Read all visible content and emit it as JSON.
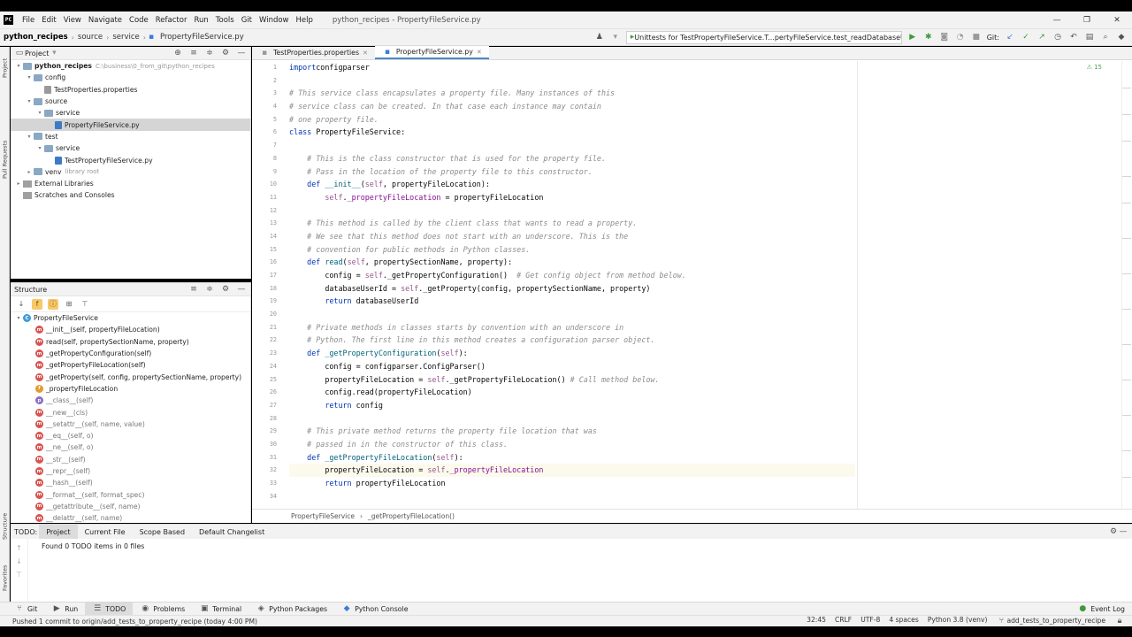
{
  "menu": [
    "File",
    "Edit",
    "View",
    "Navigate",
    "Code",
    "Refactor",
    "Run",
    "Tools",
    "Git",
    "Window",
    "Help"
  ],
  "window_title": "python_recipes - PropertyFileService.py",
  "breadcrumb": [
    "python_recipes",
    "source",
    "service",
    "PropertyFileService.py"
  ],
  "run_config": "Unittests for TestPropertyFileService.T...pertyFileService.test_readDatabaseUserId",
  "git_label": "Git:",
  "project_panel": {
    "title": "Project",
    "tree": [
      {
        "label": "python_recipes",
        "hint": "C:\\business\\0_from_git\\python_recipes",
        "depth": 0,
        "type": "proj",
        "arrow": "▾"
      },
      {
        "label": "config",
        "depth": 1,
        "type": "folder",
        "arrow": "▾"
      },
      {
        "label": "TestProperties.properties",
        "depth": 2,
        "type": "prop",
        "arrow": ""
      },
      {
        "label": "source",
        "depth": 1,
        "type": "folder",
        "arrow": "▾"
      },
      {
        "label": "service",
        "depth": 2,
        "type": "folder",
        "arrow": "▾"
      },
      {
        "label": "PropertyFileService.py",
        "depth": 3,
        "type": "py",
        "arrow": "",
        "selected": true
      },
      {
        "label": "test",
        "depth": 1,
        "type": "folder",
        "arrow": "▾"
      },
      {
        "label": "service",
        "depth": 2,
        "type": "folder",
        "arrow": "▾"
      },
      {
        "label": "TestPropertyFileService.py",
        "depth": 3,
        "type": "py",
        "arrow": ""
      },
      {
        "label": "venv",
        "hint": "library root",
        "depth": 1,
        "type": "folder",
        "arrow": "▸"
      },
      {
        "label": "External Libraries",
        "depth": 0,
        "type": "lib",
        "arrow": "▸"
      },
      {
        "label": "Scratches and Consoles",
        "depth": 0,
        "type": "lib",
        "arrow": ""
      }
    ]
  },
  "structure_panel": {
    "title": "Structure",
    "items": [
      {
        "label": "PropertyFileService",
        "badge": "c",
        "depth": 0
      },
      {
        "label": "__init__(self, propertyFileLocation)",
        "badge": "m",
        "depth": 1
      },
      {
        "label": "read(self, propertySectionName, property)",
        "badge": "m",
        "depth": 1
      },
      {
        "label": "_getPropertyConfiguration(self)",
        "badge": "m",
        "depth": 1
      },
      {
        "label": "_getPropertyFileLocation(self)",
        "badge": "m",
        "depth": 1
      },
      {
        "label": "_getProperty(self, config, propertySectionName, property)",
        "badge": "m",
        "depth": 1
      },
      {
        "label": "_propertyFileLocation",
        "badge": "f",
        "depth": 1
      },
      {
        "label": "__class__(self)",
        "badge": "p",
        "depth": 1,
        "dim": true
      },
      {
        "label": "__new__(cls)",
        "badge": "m",
        "depth": 1,
        "dim": true
      },
      {
        "label": "__setattr__(self, name, value)",
        "badge": "m",
        "depth": 1,
        "dim": true
      },
      {
        "label": "__eq__(self, o)",
        "badge": "m",
        "depth": 1,
        "dim": true
      },
      {
        "label": "__ne__(self, o)",
        "badge": "m",
        "depth": 1,
        "dim": true
      },
      {
        "label": "__str__(self)",
        "badge": "m",
        "depth": 1,
        "dim": true
      },
      {
        "label": "__repr__(self)",
        "badge": "m",
        "depth": 1,
        "dim": true
      },
      {
        "label": "__hash__(self)",
        "badge": "m",
        "depth": 1,
        "dim": true
      },
      {
        "label": "__format__(self, format_spec)",
        "badge": "m",
        "depth": 1,
        "dim": true
      },
      {
        "label": "__getattribute__(self, name)",
        "badge": "m",
        "depth": 1,
        "dim": true
      },
      {
        "label": "__delattr__(self, name)",
        "badge": "m",
        "depth": 1,
        "dim": true
      }
    ]
  },
  "editor": {
    "tabs": [
      {
        "label": "TestProperties.properties",
        "active": false
      },
      {
        "label": "PropertyFileService.py",
        "active": true
      }
    ],
    "inspection": "⚠ 15",
    "lines": [
      [
        [
          "kw",
          "import"
        ],
        [
          "",
          "configparser"
        ]
      ],
      [],
      [
        [
          "cm",
          "# This service class encapsulates a property file. Many instances of this"
        ]
      ],
      [
        [
          "cm",
          "# service class can be created. In that case each instance may contain"
        ]
      ],
      [
        [
          "cm",
          "# one property file."
        ]
      ],
      [
        [
          "kw",
          "class "
        ],
        [
          "",
          "PropertyFileService:"
        ]
      ],
      [],
      [
        [
          "cm",
          "    # This is the class constructor that is used for the property file."
        ]
      ],
      [
        [
          "cm",
          "    # Pass in the location of the property file to this constructor."
        ]
      ],
      [
        [
          "kw",
          "    def "
        ],
        [
          "fn",
          "__init__"
        ],
        [
          "",
          "("
        ],
        [
          "self",
          "self"
        ],
        [
          "",
          ", propertyFileLocation):"
        ]
      ],
      [
        [
          "self",
          "        self"
        ],
        [
          "",
          "."
        ],
        [
          "pv",
          "_propertyFileLocation"
        ],
        [
          "",
          " = propertyFileLocation"
        ]
      ],
      [],
      [
        [
          "cm",
          "    # This method is called by the client class that wants to read a property."
        ]
      ],
      [
        [
          "cm",
          "    # We see that this method does not start with an underscore. This is the"
        ]
      ],
      [
        [
          "cm",
          "    # convention for public methods in Python classes."
        ]
      ],
      [
        [
          "kw",
          "    def "
        ],
        [
          "fn",
          "read"
        ],
        [
          "",
          "("
        ],
        [
          "self",
          "self"
        ],
        [
          "",
          ", propertySectionName, property):"
        ]
      ],
      [
        [
          "",
          "        config = "
        ],
        [
          "self",
          "self"
        ],
        [
          "",
          "._getPropertyConfiguration()  "
        ],
        [
          "cm",
          "# Get config object from method below."
        ]
      ],
      [
        [
          "",
          "        databaseUserId = "
        ],
        [
          "self",
          "self"
        ],
        [
          "",
          "._getProperty(config, propertySectionName, property)"
        ]
      ],
      [
        [
          "kw",
          "        return "
        ],
        [
          "",
          "databaseUserId"
        ]
      ],
      [],
      [
        [
          "cm",
          "    # Private methods in classes starts by convention with an underscore in"
        ]
      ],
      [
        [
          "cm",
          "    # Python. The first line in this method creates a configuration parser object."
        ]
      ],
      [
        [
          "kw",
          "    def "
        ],
        [
          "fn",
          "_getPropertyConfiguration"
        ],
        [
          "",
          "("
        ],
        [
          "self",
          "self"
        ],
        [
          "",
          "):"
        ]
      ],
      [
        [
          "",
          "        config = configparser.ConfigParser()"
        ]
      ],
      [
        [
          "",
          "        propertyFileLocation = "
        ],
        [
          "self",
          "self"
        ],
        [
          "",
          "._getPropertyFileLocation() "
        ],
        [
          "cm",
          "# Call method below."
        ]
      ],
      [
        [
          "",
          "        config.read(propertyFileLocation)"
        ]
      ],
      [
        [
          "kw",
          "        return "
        ],
        [
          "",
          "config"
        ]
      ],
      [],
      [
        [
          "cm",
          "    # This private method returns the property file location that was"
        ]
      ],
      [
        [
          "cm",
          "    # passed in in the constructor of this class."
        ]
      ],
      [
        [
          "kw",
          "    def "
        ],
        [
          "fn",
          "_getPropertyFileLocation"
        ],
        [
          "",
          "("
        ],
        [
          "self",
          "self"
        ],
        [
          "",
          "):"
        ]
      ],
      [
        [
          "",
          "        propertyFileLocation = "
        ],
        [
          "self",
          "self"
        ],
        [
          "",
          "."
        ],
        [
          "pv",
          "_propertyFileLocation"
        ]
      ],
      [
        [
          "kw",
          "        return "
        ],
        [
          "",
          "propertyFileLocation"
        ]
      ],
      []
    ],
    "line_numbers": [
      "1",
      "2",
      "3",
      "4",
      "5",
      "6",
      "7",
      "8",
      "9",
      "10",
      "11",
      "12",
      "13",
      "14",
      "15",
      "16",
      "17",
      "18",
      "19",
      "20",
      "21",
      "22",
      "23",
      "24",
      "25",
      "26",
      "27",
      "28",
      "29",
      "30",
      "31",
      "32",
      "33",
      "34"
    ],
    "current_line_index": 31,
    "crumbs": [
      "PropertyFileService",
      "_getPropertyFileLocation()"
    ]
  },
  "todo": {
    "label": "TODO:",
    "tabs": [
      "Project",
      "Current File",
      "Scope Based",
      "Default Changelist"
    ],
    "message": "Found 0 TODO items in 0 files"
  },
  "tool_windows": [
    "Git",
    "Run",
    "TODO",
    "Problems",
    "Terminal",
    "Python Packages",
    "Python Console"
  ],
  "event_log": "Event Log",
  "status": {
    "message": "Pushed 1 commit to origin/add_tests_to_property_recipe (today 4:00 PM)",
    "position": "32:45",
    "line_sep": "CRLF",
    "encoding": "UTF-8",
    "indent": "4 spaces",
    "interpreter": "Python 3.8 (venv)",
    "branch": "add_tests_to_property_recipe"
  },
  "side_tabs": {
    "project": "Project",
    "pull": "Pull Requests",
    "structure": "Structure",
    "favorites": "Favorites"
  }
}
